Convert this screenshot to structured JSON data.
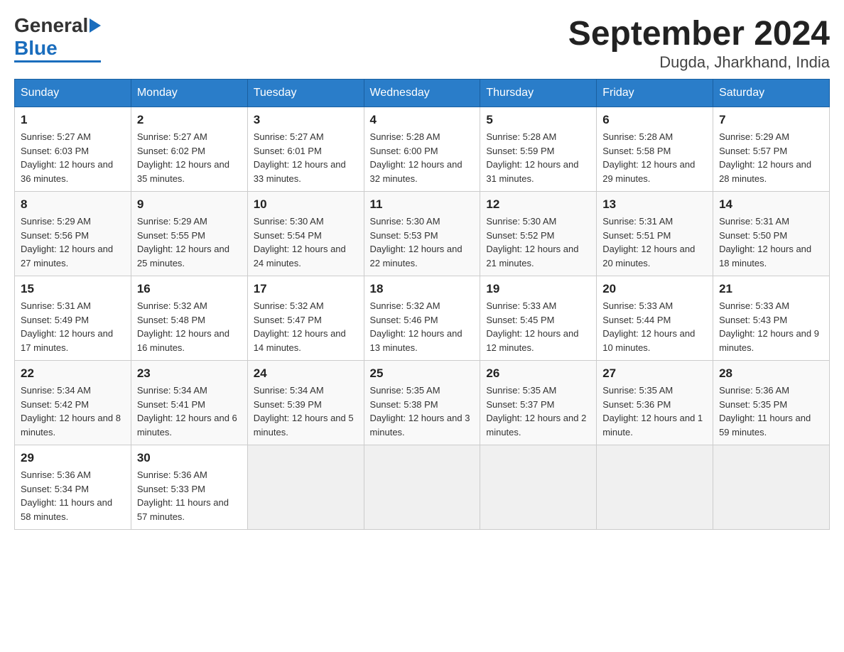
{
  "header": {
    "logo_general": "General",
    "logo_blue": "Blue",
    "title": "September 2024",
    "subtitle": "Dugda, Jharkhand, India"
  },
  "weekdays": [
    "Sunday",
    "Monday",
    "Tuesday",
    "Wednesday",
    "Thursday",
    "Friday",
    "Saturday"
  ],
  "weeks": [
    [
      {
        "day": "1",
        "sunrise": "Sunrise: 5:27 AM",
        "sunset": "Sunset: 6:03 PM",
        "daylight": "Daylight: 12 hours and 36 minutes."
      },
      {
        "day": "2",
        "sunrise": "Sunrise: 5:27 AM",
        "sunset": "Sunset: 6:02 PM",
        "daylight": "Daylight: 12 hours and 35 minutes."
      },
      {
        "day": "3",
        "sunrise": "Sunrise: 5:27 AM",
        "sunset": "Sunset: 6:01 PM",
        "daylight": "Daylight: 12 hours and 33 minutes."
      },
      {
        "day": "4",
        "sunrise": "Sunrise: 5:28 AM",
        "sunset": "Sunset: 6:00 PM",
        "daylight": "Daylight: 12 hours and 32 minutes."
      },
      {
        "day": "5",
        "sunrise": "Sunrise: 5:28 AM",
        "sunset": "Sunset: 5:59 PM",
        "daylight": "Daylight: 12 hours and 31 minutes."
      },
      {
        "day": "6",
        "sunrise": "Sunrise: 5:28 AM",
        "sunset": "Sunset: 5:58 PM",
        "daylight": "Daylight: 12 hours and 29 minutes."
      },
      {
        "day": "7",
        "sunrise": "Sunrise: 5:29 AM",
        "sunset": "Sunset: 5:57 PM",
        "daylight": "Daylight: 12 hours and 28 minutes."
      }
    ],
    [
      {
        "day": "8",
        "sunrise": "Sunrise: 5:29 AM",
        "sunset": "Sunset: 5:56 PM",
        "daylight": "Daylight: 12 hours and 27 minutes."
      },
      {
        "day": "9",
        "sunrise": "Sunrise: 5:29 AM",
        "sunset": "Sunset: 5:55 PM",
        "daylight": "Daylight: 12 hours and 25 minutes."
      },
      {
        "day": "10",
        "sunrise": "Sunrise: 5:30 AM",
        "sunset": "Sunset: 5:54 PM",
        "daylight": "Daylight: 12 hours and 24 minutes."
      },
      {
        "day": "11",
        "sunrise": "Sunrise: 5:30 AM",
        "sunset": "Sunset: 5:53 PM",
        "daylight": "Daylight: 12 hours and 22 minutes."
      },
      {
        "day": "12",
        "sunrise": "Sunrise: 5:30 AM",
        "sunset": "Sunset: 5:52 PM",
        "daylight": "Daylight: 12 hours and 21 minutes."
      },
      {
        "day": "13",
        "sunrise": "Sunrise: 5:31 AM",
        "sunset": "Sunset: 5:51 PM",
        "daylight": "Daylight: 12 hours and 20 minutes."
      },
      {
        "day": "14",
        "sunrise": "Sunrise: 5:31 AM",
        "sunset": "Sunset: 5:50 PM",
        "daylight": "Daylight: 12 hours and 18 minutes."
      }
    ],
    [
      {
        "day": "15",
        "sunrise": "Sunrise: 5:31 AM",
        "sunset": "Sunset: 5:49 PM",
        "daylight": "Daylight: 12 hours and 17 minutes."
      },
      {
        "day": "16",
        "sunrise": "Sunrise: 5:32 AM",
        "sunset": "Sunset: 5:48 PM",
        "daylight": "Daylight: 12 hours and 16 minutes."
      },
      {
        "day": "17",
        "sunrise": "Sunrise: 5:32 AM",
        "sunset": "Sunset: 5:47 PM",
        "daylight": "Daylight: 12 hours and 14 minutes."
      },
      {
        "day": "18",
        "sunrise": "Sunrise: 5:32 AM",
        "sunset": "Sunset: 5:46 PM",
        "daylight": "Daylight: 12 hours and 13 minutes."
      },
      {
        "day": "19",
        "sunrise": "Sunrise: 5:33 AM",
        "sunset": "Sunset: 5:45 PM",
        "daylight": "Daylight: 12 hours and 12 minutes."
      },
      {
        "day": "20",
        "sunrise": "Sunrise: 5:33 AM",
        "sunset": "Sunset: 5:44 PM",
        "daylight": "Daylight: 12 hours and 10 minutes."
      },
      {
        "day": "21",
        "sunrise": "Sunrise: 5:33 AM",
        "sunset": "Sunset: 5:43 PM",
        "daylight": "Daylight: 12 hours and 9 minutes."
      }
    ],
    [
      {
        "day": "22",
        "sunrise": "Sunrise: 5:34 AM",
        "sunset": "Sunset: 5:42 PM",
        "daylight": "Daylight: 12 hours and 8 minutes."
      },
      {
        "day": "23",
        "sunrise": "Sunrise: 5:34 AM",
        "sunset": "Sunset: 5:41 PM",
        "daylight": "Daylight: 12 hours and 6 minutes."
      },
      {
        "day": "24",
        "sunrise": "Sunrise: 5:34 AM",
        "sunset": "Sunset: 5:39 PM",
        "daylight": "Daylight: 12 hours and 5 minutes."
      },
      {
        "day": "25",
        "sunrise": "Sunrise: 5:35 AM",
        "sunset": "Sunset: 5:38 PM",
        "daylight": "Daylight: 12 hours and 3 minutes."
      },
      {
        "day": "26",
        "sunrise": "Sunrise: 5:35 AM",
        "sunset": "Sunset: 5:37 PM",
        "daylight": "Daylight: 12 hours and 2 minutes."
      },
      {
        "day": "27",
        "sunrise": "Sunrise: 5:35 AM",
        "sunset": "Sunset: 5:36 PM",
        "daylight": "Daylight: 12 hours and 1 minute."
      },
      {
        "day": "28",
        "sunrise": "Sunrise: 5:36 AM",
        "sunset": "Sunset: 5:35 PM",
        "daylight": "Daylight: 11 hours and 59 minutes."
      }
    ],
    [
      {
        "day": "29",
        "sunrise": "Sunrise: 5:36 AM",
        "sunset": "Sunset: 5:34 PM",
        "daylight": "Daylight: 11 hours and 58 minutes."
      },
      {
        "day": "30",
        "sunrise": "Sunrise: 5:36 AM",
        "sunset": "Sunset: 5:33 PM",
        "daylight": "Daylight: 11 hours and 57 minutes."
      },
      null,
      null,
      null,
      null,
      null
    ]
  ]
}
